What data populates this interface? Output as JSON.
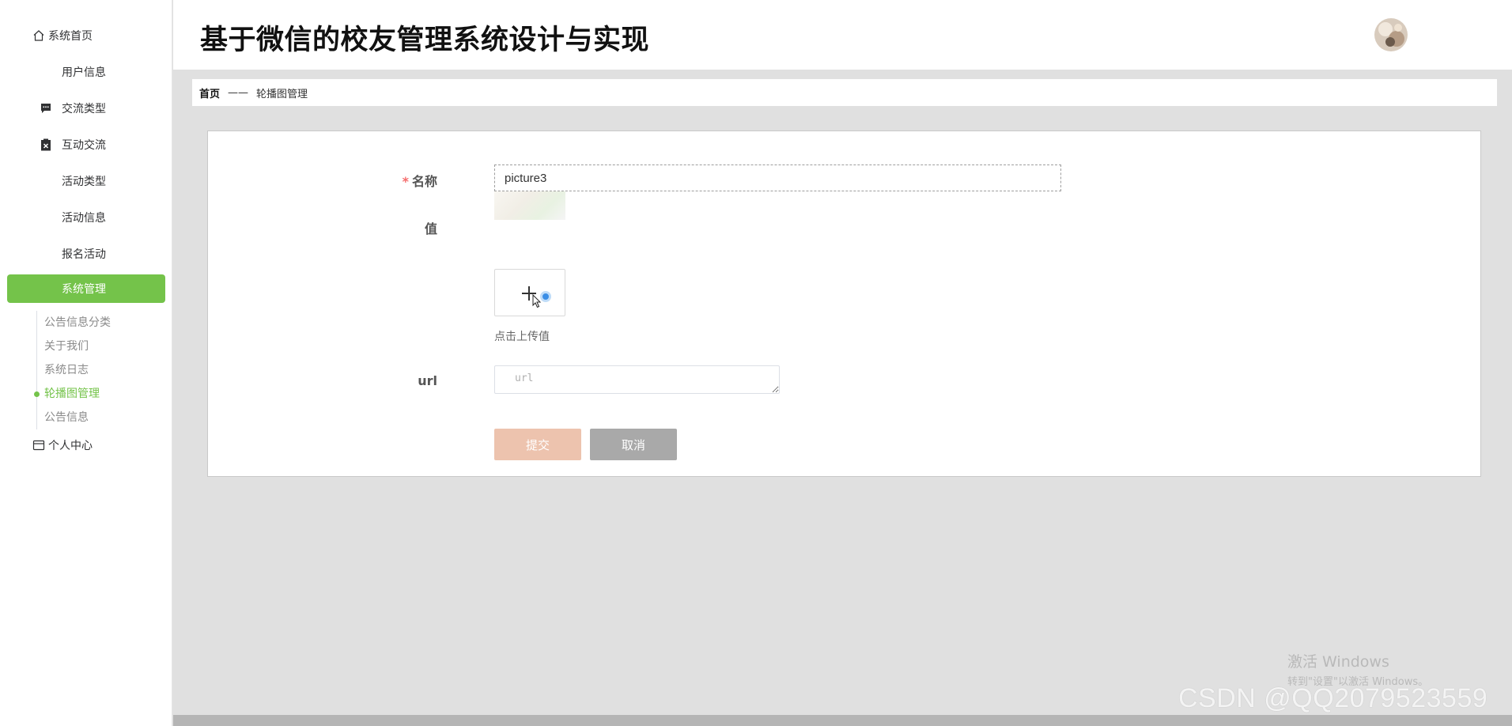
{
  "app": {
    "title": "基于微信的校友管理系统设计与实现"
  },
  "sidebar": {
    "items": [
      {
        "label": "系统首页",
        "icon": "home-icon"
      },
      {
        "label": "用户信息",
        "icon": "grid-icon"
      },
      {
        "label": "交流类型",
        "icon": "comment-icon"
      },
      {
        "label": "互动交流",
        "icon": "clipboard-icon"
      },
      {
        "label": "活动类型",
        "icon": "grid-icon"
      },
      {
        "label": "活动信息",
        "icon": "grid-icon"
      },
      {
        "label": "报名活动",
        "icon": "grid-icon"
      },
      {
        "label": "系统管理",
        "icon": "grid-icon",
        "active": true
      }
    ],
    "submenu": [
      {
        "label": "公告信息分类"
      },
      {
        "label": "关于我们"
      },
      {
        "label": "系统日志"
      },
      {
        "label": "轮播图管理",
        "active": true
      },
      {
        "label": "公告信息"
      }
    ],
    "profile": {
      "label": "个人中心",
      "icon": "wallet-icon"
    },
    "active_color": "#74c34a"
  },
  "breadcrumb": {
    "home": "首页",
    "separator": "——",
    "current": "轮播图管理"
  },
  "form": {
    "name_label": "名称",
    "required_mark": "*",
    "name_value": "picture3",
    "value_label": "值",
    "upload_hint": "点击上传值",
    "url_label": "url",
    "url_placeholder": "url",
    "submit_label": "提交",
    "cancel_label": "取消",
    "submit_color": "#edc3ae",
    "cancel_color": "#a9a9a9"
  },
  "watermark": {
    "windows_title": "激活 Windows",
    "windows_sub": "转到\"设置\"以激活 Windows。",
    "csdn": "CSDN @QQ2079523559"
  }
}
